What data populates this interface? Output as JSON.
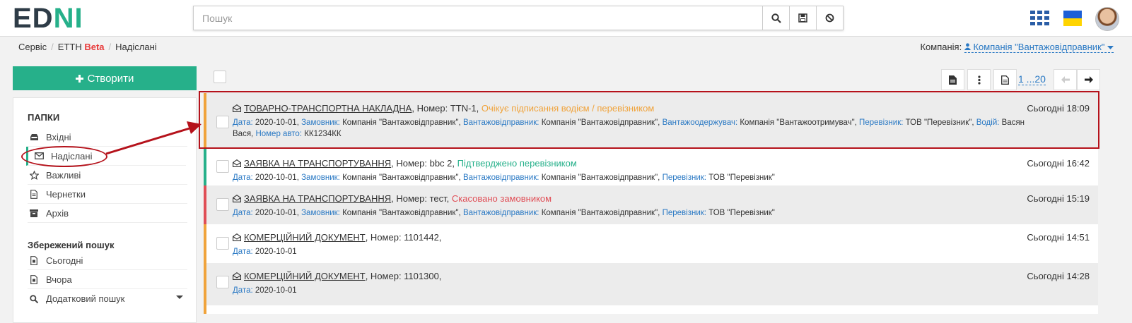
{
  "header": {
    "logo_main": "ED",
    "logo_accent": "N",
    "logo_end": "I",
    "search_placeholder": "Пошук",
    "search_icon": "search-icon",
    "save_icon": "save-icon",
    "clear_icon": "ban-icon",
    "apps_icon": "grid-icon",
    "flag_colors": [
      "#1c5fd6",
      "#ffd400"
    ]
  },
  "breadcrumb": {
    "items": [
      "Сервіс",
      "ЕТТН",
      "Надіслані"
    ],
    "beta": "Beta",
    "separator": "/"
  },
  "company": {
    "label": "Компанія:",
    "value": "Компанія \"Вантажовідправник\""
  },
  "sidebar": {
    "create_label": "Створити",
    "folders_title": "ПАПКИ",
    "folders": [
      {
        "label": "Вхідні",
        "icon": "inbox-icon"
      },
      {
        "label": "Надіслані",
        "icon": "envelope-icon"
      },
      {
        "label": "Важливі",
        "icon": "star-icon"
      },
      {
        "label": "Чернетки",
        "icon": "file-icon"
      },
      {
        "label": "Архів",
        "icon": "archive-icon"
      }
    ],
    "saved_title": "Збережений пошук",
    "saved": [
      {
        "label": "Сьогодні",
        "icon": "calendar-icon"
      },
      {
        "label": "Вчора",
        "icon": "calendar-icon"
      },
      {
        "label": "Додатковий пошук",
        "icon": "search-icon"
      }
    ]
  },
  "toolbar": {
    "pager": "1 ...20"
  },
  "documents": [
    {
      "title": "ТОВАРНО-ТРАНСПОРТНА НАКЛАДНА",
      "number": ", Номер: TTN-1,",
      "status": "Очікує підписання водієм / перевізником",
      "status_color": "orange",
      "time": "Сьогодні 18:09",
      "meta": [
        [
          "Дата:",
          "2020-10-01,"
        ],
        [
          "Замовник:",
          "Компанія \"Вантажовідправник\","
        ],
        [
          "Вантажовідправник:",
          "Компанія \"Вантажовідправник\","
        ],
        [
          "Вантажоодержувач:",
          "Компанія \"Вантажоотримувач\","
        ],
        [
          "Перевізник:",
          "ТОВ \"Перевізник\","
        ],
        [
          "Водій:",
          "Васян Вася,"
        ],
        [
          "Номер авто:",
          "КК1234КК"
        ]
      ]
    },
    {
      "title": "ЗАЯВКА НА ТРАНСПОРТУВАННЯ",
      "number": ", Номер: bbc 2,",
      "status": "Підтверджено перевізником",
      "status_color": "green",
      "time": "Сьогодні 16:42",
      "meta": [
        [
          "Дата:",
          "2020-10-01,"
        ],
        [
          "Замовник:",
          "Компанія \"Вантажовідправник\","
        ],
        [
          "Вантажовідправник:",
          "Компанія \"Вантажовідправник\","
        ],
        [
          "Перевізник:",
          "ТОВ \"Перевізник\""
        ]
      ]
    },
    {
      "title": "ЗАЯВКА НА ТРАНСПОРТУВАННЯ",
      "number": ", Номер: тест,",
      "status": "Скасовано замовником",
      "status_color": "red",
      "time": "Сьогодні 15:19",
      "meta": [
        [
          "Дата:",
          "2020-10-01,"
        ],
        [
          "Замовник:",
          "Компанія \"Вантажовідправник\","
        ],
        [
          "Вантажовідправник:",
          "Компанія \"Вантажовідправник\","
        ],
        [
          "Перевізник:",
          "ТОВ \"Перевізник\""
        ]
      ]
    },
    {
      "title": "КОМЕРЦІЙНИЙ ДОКУМЕНТ",
      "number": ", Номер: 1101442,",
      "status": "",
      "status_color": "orange",
      "time": "Сьогодні 14:51",
      "meta": [
        [
          "Дата:",
          "2020-10-01"
        ]
      ]
    },
    {
      "title": "КОМЕРЦІЙНИЙ ДОКУМЕНТ",
      "number": ", Номер: 1101300,",
      "status": "",
      "status_color": "orange",
      "time": "Сьогодні 14:28",
      "meta": [
        [
          "Дата:",
          "2020-10-01"
        ]
      ]
    }
  ],
  "annotation_color": "#b5121b"
}
